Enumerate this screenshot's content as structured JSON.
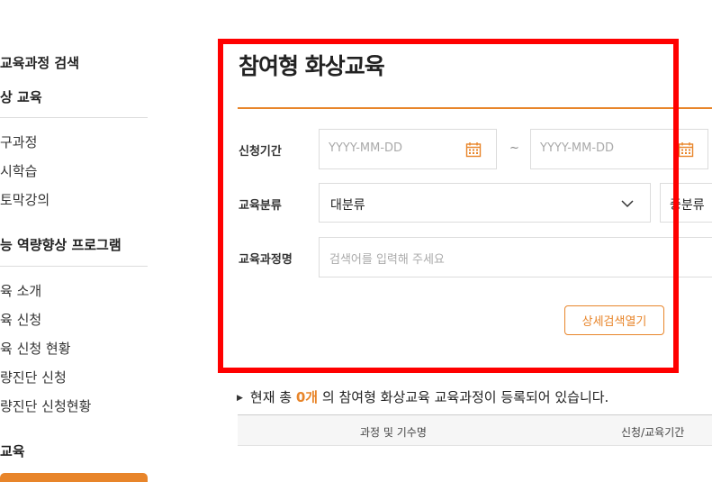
{
  "sidebar": {
    "items": [
      {
        "label": "교육과정 검색",
        "type": "group"
      },
      {
        "label": "상 교육",
        "type": "group"
      },
      {
        "label": "구과정",
        "type": "item"
      },
      {
        "label": "시학습",
        "type": "item"
      },
      {
        "label": "토막강의",
        "type": "item"
      },
      {
        "label": "능 역량향상 프로그램",
        "type": "group"
      },
      {
        "label": "육 소개",
        "type": "item"
      },
      {
        "label": "육 신청",
        "type": "item"
      },
      {
        "label": "육 신청 현황",
        "type": "item"
      },
      {
        "label": "량진단 신청",
        "type": "item"
      },
      {
        "label": "량진단 신청현황",
        "type": "item"
      },
      {
        "label": "교육",
        "type": "group"
      }
    ]
  },
  "main": {
    "title": "참여형 화상교육",
    "form": {
      "period_label": "신청기간",
      "date_start_placeholder": "YYYY-MM-DD",
      "date_separator": "~",
      "date_end_placeholder": "YYYY-MM-DD",
      "category_label": "교육분류",
      "category_major": "대분류",
      "category_middle": "중분류",
      "course_name_label": "교육과정명",
      "course_name_placeholder": "검색어를 입력해 주세요",
      "detail_search_button": "상세검색열기"
    },
    "summary": {
      "prefix": "현재 총",
      "count": "0개",
      "suffix": "의 참여형 화상교육 교육과정이 등록되어 있습니다."
    },
    "table": {
      "columns": [
        "과정 및 기수명",
        "신청/교육기간"
      ]
    }
  },
  "colors": {
    "accent": "#e8852a",
    "highlight": "#ff0000"
  }
}
